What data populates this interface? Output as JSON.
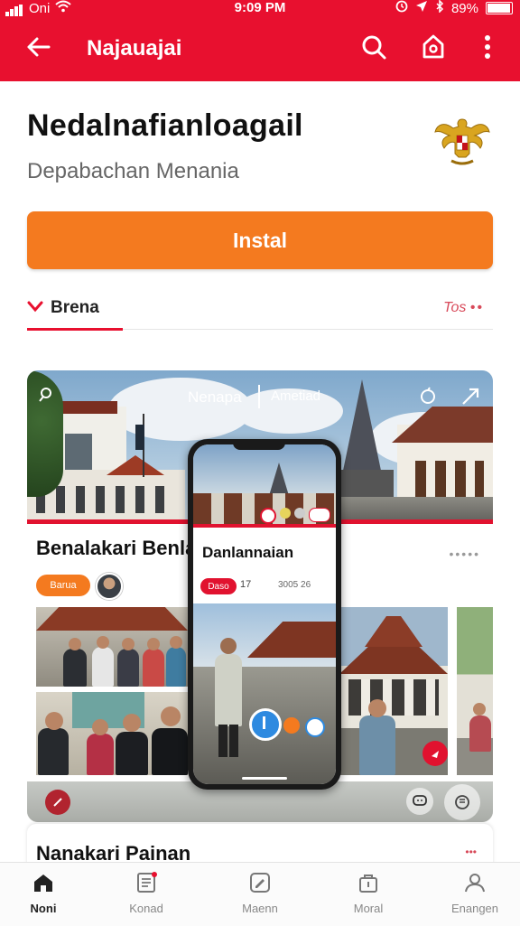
{
  "status_bar": {
    "carrier": "Oni",
    "time": "9:09 PM",
    "battery": "89%",
    "battery_level": 0.89
  },
  "app_bar": {
    "title": "Najauajai"
  },
  "app": {
    "name": "Nedalnafianloagail",
    "developer": "Depabachan Menania",
    "install_label": "Instal"
  },
  "section_tabs": {
    "active": "Brena",
    "right": "Tos"
  },
  "gallery": {
    "overlay_left": "Nenapa",
    "overlay_right": "Ametiad",
    "card_title": "Benalakari Benla",
    "badge": "Barua",
    "phone_card_title": "Danlannaian",
    "phone_badge": "Daso",
    "phone_meta": "17",
    "phone_meta2": "3005 26"
  },
  "next_card": {
    "title": "Nanakari Painan"
  },
  "bottom_nav": [
    {
      "label": "Noni",
      "icon": "home-icon",
      "active": true
    },
    {
      "label": "Konad",
      "icon": "news-icon",
      "active": false
    },
    {
      "label": "Maenn",
      "icon": "edit-icon",
      "active": false
    },
    {
      "label": "Moral",
      "icon": "bag-icon",
      "active": false
    },
    {
      "label": "Enangen",
      "icon": "profile-icon",
      "active": false
    }
  ],
  "colors": {
    "primary": "#e8102f",
    "accent": "#f47a1f"
  }
}
